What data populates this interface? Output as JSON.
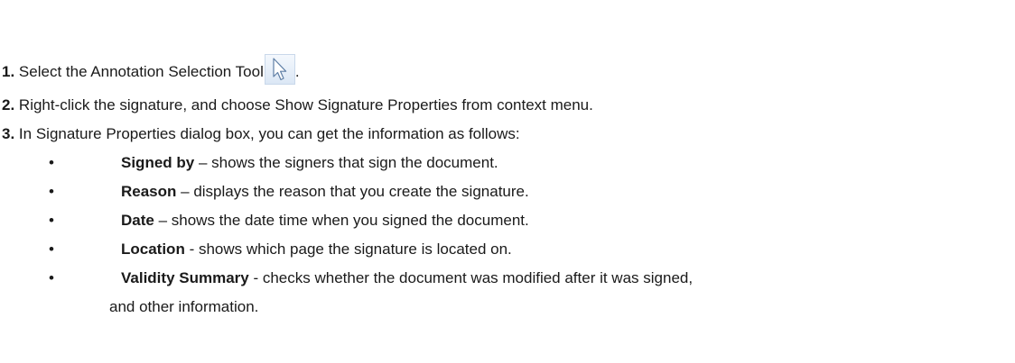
{
  "steps": [
    {
      "num": "1.",
      "text": "Select the Annotation Selection Tool",
      "suffix": "."
    },
    {
      "num": "2.",
      "text": "Right-click the signature, and choose Show Signature Properties from context menu."
    },
    {
      "num": "3.",
      "text": "In Signature Properties dialog box, you can get the information as follows:"
    }
  ],
  "icons": {
    "selection_tool": "arrow-cursor-icon"
  },
  "bullets": [
    {
      "term": "Signed by",
      "desc": " – shows the signers that sign the document."
    },
    {
      "term": "Reason",
      "desc": " – displays the reason that you create the signature."
    },
    {
      "term": "Date",
      "desc": " – shows the date time when you signed the document."
    },
    {
      "term": "Location",
      "desc": " - shows which page the signature is located on."
    },
    {
      "term": "Validity Summary",
      "desc": " - checks whether the document was modified after it was signed,",
      "desc_line2": "and other information."
    }
  ],
  "bullet_char": "•"
}
